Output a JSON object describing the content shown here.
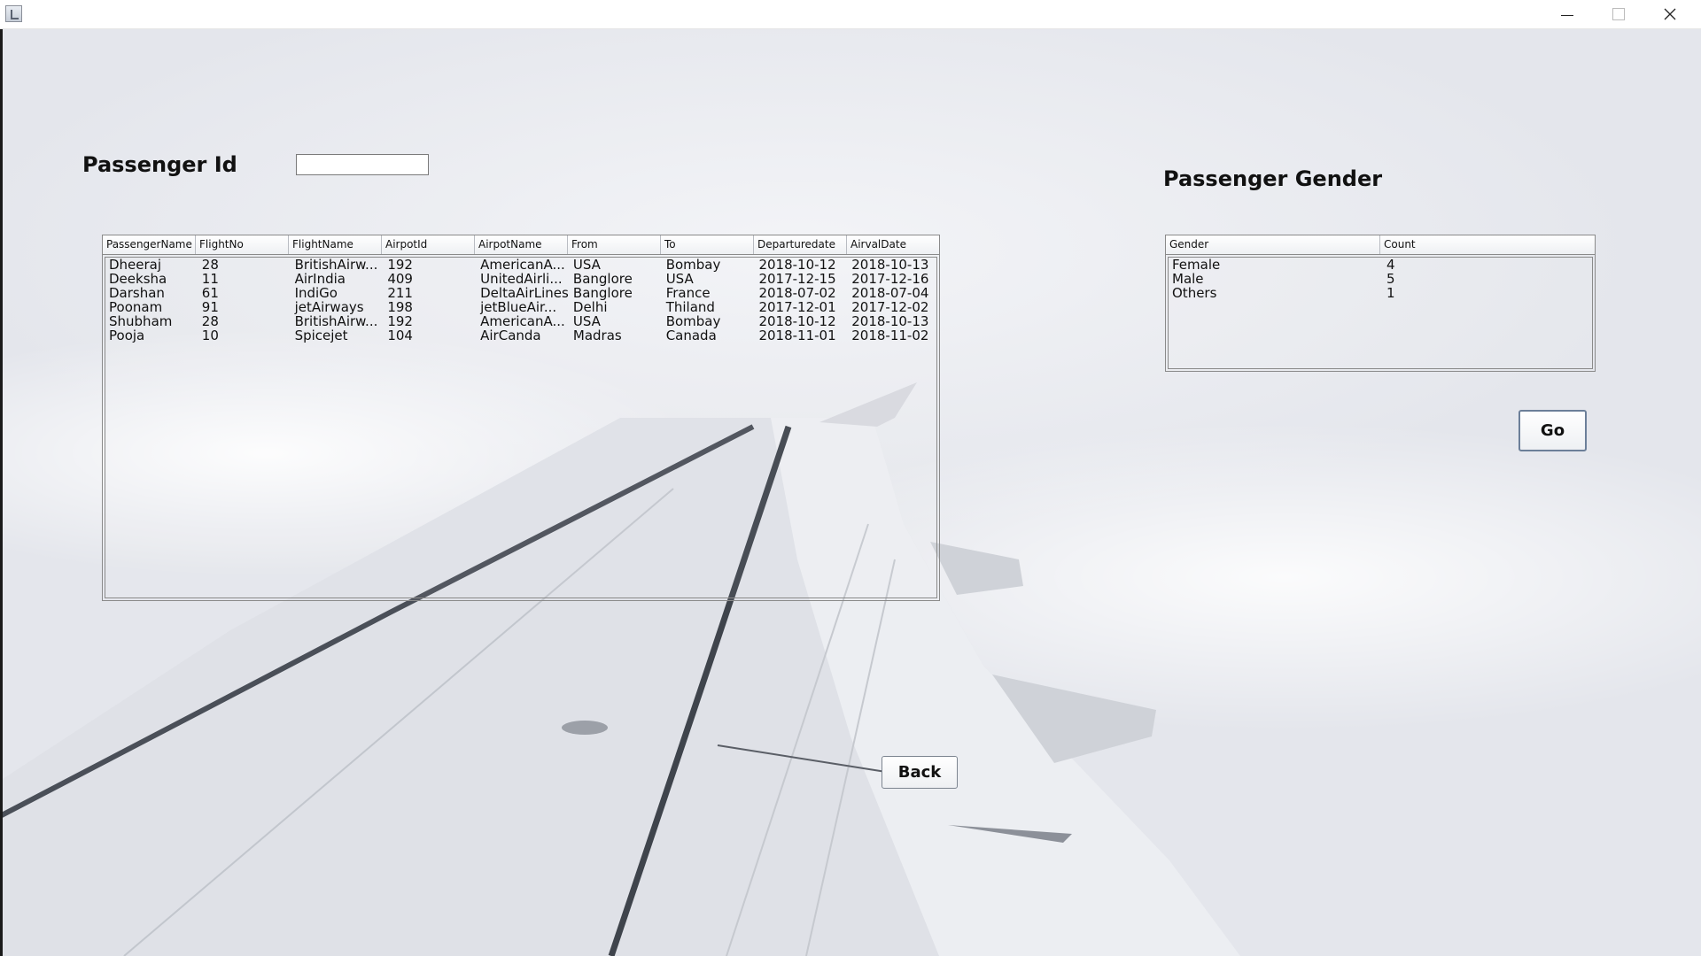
{
  "window": {
    "minimize_icon": "minimize-icon",
    "maximize_icon": "maximize-icon",
    "close_icon": "close-icon"
  },
  "form": {
    "passenger_id_label": "Passenger Id",
    "passenger_id_value": "",
    "passenger_gender_label": "Passenger Gender"
  },
  "flights_table": {
    "columns": [
      "PassengerName",
      "FlightNo",
      "FlightName",
      "AirpotId",
      "AirpotName",
      "From",
      "To",
      "Departuredate",
      "AirvalDate"
    ],
    "rows": [
      [
        "Dheeraj",
        "28",
        "BritishAirw...",
        "192",
        "AmericanA...",
        "USA",
        "Bombay",
        "2018-10-12",
        "2018-10-13"
      ],
      [
        "Deeksha",
        "11",
        "AirIndia",
        "409",
        "UnitedAirli...",
        "Banglore",
        "USA",
        "2017-12-15",
        "2017-12-16"
      ],
      [
        "Darshan",
        "61",
        "IndiGo",
        "211",
        "DeltaAirLines",
        "Banglore",
        "France",
        "2018-07-02",
        "2018-07-04"
      ],
      [
        "Poonam",
        "91",
        "jetAirways",
        "198",
        "jetBlueAir...",
        "Delhi",
        "Thiland",
        "2017-12-01",
        "2017-12-02"
      ],
      [
        "Shubham",
        "28",
        "BritishAirw...",
        "192",
        "AmericanA...",
        "USA",
        "Bombay",
        "2018-10-12",
        "2018-10-13"
      ],
      [
        "Pooja",
        "10",
        "Spicejet",
        "104",
        "AirCanda",
        "Madras",
        "Canada",
        "2018-11-01",
        "2018-11-02"
      ]
    ]
  },
  "gender_table": {
    "columns": [
      "Gender",
      "Count"
    ],
    "rows": [
      [
        "Female",
        "4"
      ],
      [
        "Male",
        "5"
      ],
      [
        "Others",
        "1"
      ]
    ]
  },
  "buttons": {
    "go": "Go",
    "back": "Back"
  }
}
